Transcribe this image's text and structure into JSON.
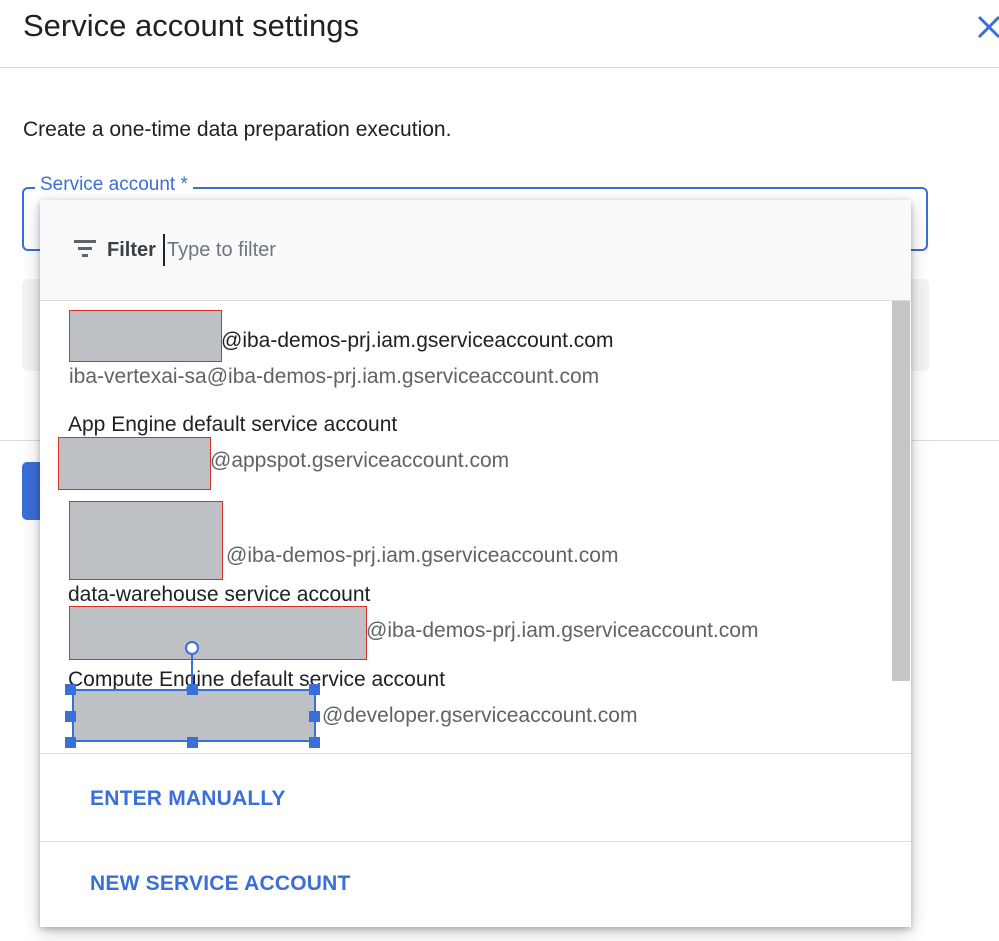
{
  "header": {
    "title": "Service account settings",
    "close_icon": "close-icon"
  },
  "description": "Create a one-time data preparation execution.",
  "field": {
    "label": "Service account *"
  },
  "dropdown": {
    "filter": {
      "label": "Filter",
      "placeholder": "Type to filter",
      "value": ""
    },
    "items": [
      {
        "name_suffix": "@iba-demos-prj.iam.gserviceaccount.com",
        "email": "iba-vertexai-sa@iba-demos-prj.iam.gserviceaccount.com"
      },
      {
        "name": "App Engine default service account",
        "email_suffix": "@appspot.gserviceaccount.com"
      },
      {
        "email_suffix": "@iba-demos-prj.iam.gserviceaccount.com"
      },
      {
        "name": "data-warehouse service account",
        "email_suffix": "@iba-demos-prj.iam.gserviceaccount.com"
      },
      {
        "name": "Compute Engine default service account",
        "email_suffix": "@developer.gserviceaccount.com"
      }
    ],
    "actions": {
      "enter_manually": "ENTER MANUALLY",
      "new_service_account": "NEW SERVICE ACCOUNT"
    }
  },
  "colors": {
    "accent": "#3a6fd8",
    "redaction_fill": "#bdc1c6",
    "redaction_border": "#d93025"
  }
}
